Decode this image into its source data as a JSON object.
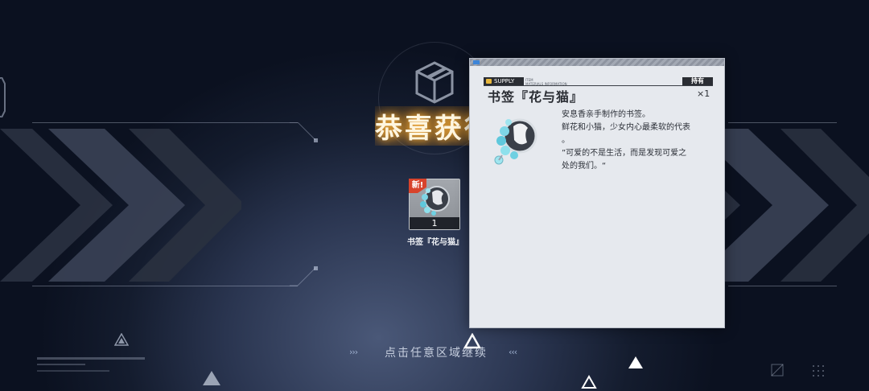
{
  "reward": {
    "title": "恭喜获得",
    "continue_hint": "点击任意区域继续",
    "arrow_left": "›››",
    "arrow_right": "‹‹‹"
  },
  "item": {
    "name": "书签『花与猫』",
    "count": "1",
    "new_badge": "新!"
  },
  "popup": {
    "supply_tag": "SUPPLY",
    "materials_label_1": "ITEM",
    "materials_label_2": "MATERIALS INFORMATION",
    "hold_label": "持有",
    "hold_count": "×1",
    "title": "书签『花与猫』",
    "description": [
      "安息香亲手制作的书签。",
      "鲜花和小猫，少女内心最柔软的代表",
      "。",
      "”可爱的不是生活，而是发现可爱之",
      "处的我们。“"
    ]
  },
  "icons": {
    "reward_box": "cube-box-icon",
    "item": "bookmark-cat-flower-icon"
  },
  "colors": {
    "title_glow": "#ffb640",
    "new_badge": "#d8432b",
    "popup_bg": "#e6e9ee",
    "tag_bg": "#2a2d33",
    "supply_accent": "#e9b83d"
  }
}
